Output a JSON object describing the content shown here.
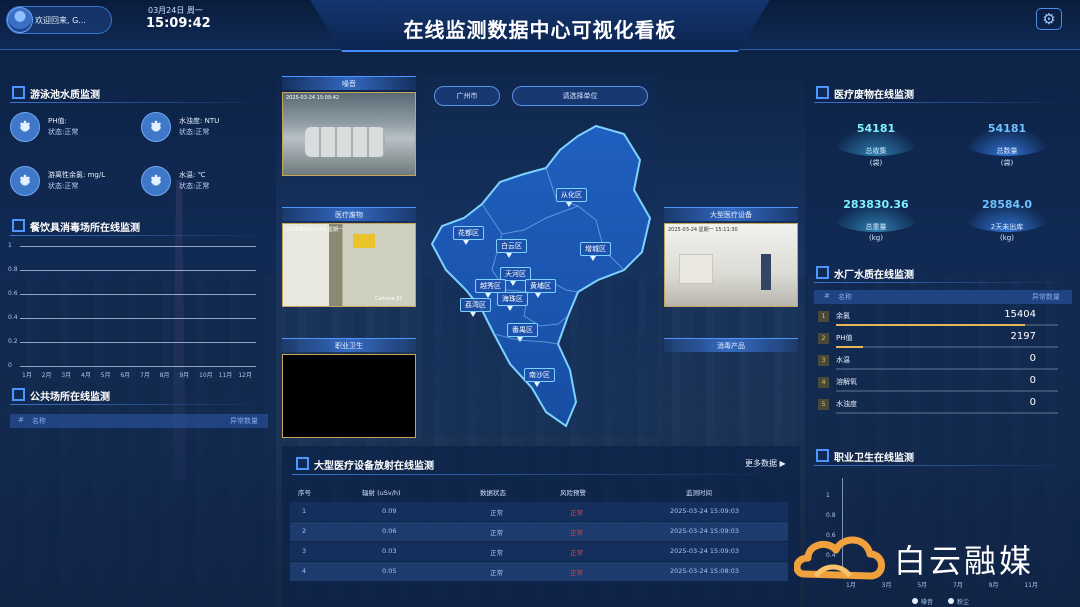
{
  "header": {
    "welcome": "欢迎回来, G...",
    "date": "03月24日 周一",
    "time": "15:09:42",
    "title": "在线监测数据中心可视化看板"
  },
  "pool": {
    "title": "游泳池水质监测",
    "items": [
      {
        "label": "PH值:",
        "status": "状态:正常"
      },
      {
        "label": "水浊度: NTU",
        "status": "状态:正常"
      },
      {
        "label": "游离性余氯: mg/L",
        "status": "状态:正常"
      },
      {
        "label": "水温: ℃",
        "status": "状态:正常"
      }
    ]
  },
  "tableware": {
    "title": "餐饮具消毒场所在线监测",
    "y_ticks": [
      "1",
      "0.8",
      "0.6",
      "0.4",
      "0.2",
      "0"
    ],
    "x_ticks": [
      "1月",
      "2月",
      "3月",
      "4月",
      "5月",
      "6月",
      "7月",
      "8月",
      "9月",
      "10月",
      "11月",
      "12月"
    ]
  },
  "public_places": {
    "title": "公共场所在线监测",
    "col_index": "#",
    "col_name": "名称",
    "col_abnormal": "异常数量"
  },
  "cameras": {
    "noise": {
      "label": "噪音",
      "stamp": "2025-03-24 15:09:42"
    },
    "medical_waste": {
      "label": "医疗废物",
      "stamp": "2025年03月24日 星期一",
      "cam_label": "Camera 01"
    },
    "occupational": {
      "label": "职业卫生"
    },
    "large_device": {
      "label": "大型医疗设备",
      "stamp": "2025-03-24 星期一 15:11:30"
    },
    "disinfect": {
      "label": "消毒产品"
    }
  },
  "map": {
    "city_select": "广州市",
    "unit_select": "请选择单位",
    "districts": [
      "从化区",
      "花都区",
      "白云区",
      "增城区",
      "天河区",
      "越秀区",
      "黄埔区",
      "荔湾区",
      "海珠区",
      "番禺区",
      "南沙区"
    ]
  },
  "radiation": {
    "title": "大型医疗设备放射在线监测",
    "more": "更多数据 ▶",
    "headers": [
      "序号",
      "辐射 (uSv/h)",
      "数据状态",
      "风险预警",
      "监测时间"
    ],
    "rows": [
      {
        "idx": "1",
        "value": "0.09",
        "status": "正常",
        "risk": "正常",
        "time": "2025-03-24 15:09:03"
      },
      {
        "idx": "2",
        "value": "0.06",
        "status": "正常",
        "risk": "正常",
        "time": "2025-03-24 15:09:03"
      },
      {
        "idx": "3",
        "value": "0.03",
        "status": "正常",
        "risk": "正常",
        "time": "2025-03-24 15:09:03"
      },
      {
        "idx": "4",
        "value": "0.05",
        "status": "正常",
        "risk": "正常",
        "time": "2025-03-24 15:08:03"
      }
    ]
  },
  "medwaste": {
    "title": "医疗废物在线监测",
    "stats": [
      {
        "value": "54181",
        "name": "总收集",
        "unit": "(袋)"
      },
      {
        "value": "54181",
        "name": "总数量",
        "unit": "(袋)"
      },
      {
        "value": "283830.36",
        "name": "总重量",
        "unit": "(kg)"
      },
      {
        "value": "28584.0",
        "name": "2天未出库",
        "unit": "(kg)"
      }
    ]
  },
  "waterplant": {
    "title": "水厂水质在线监测",
    "col_index": "#",
    "col_name": "名称",
    "col_abnormal": "异常数量",
    "rows": [
      {
        "rank": "1",
        "name": "余氯",
        "value": "15404",
        "fill": 0.85
      },
      {
        "rank": "2",
        "name": "PH值",
        "value": "2197",
        "fill": 0.12
      },
      {
        "rank": "3",
        "name": "水温",
        "value": "0",
        "fill": 0
      },
      {
        "rank": "4",
        "name": "溶解氧",
        "value": "0",
        "fill": 0
      },
      {
        "rank": "5",
        "name": "水浊度",
        "value": "0",
        "fill": 0
      }
    ]
  },
  "occhealth": {
    "title": "职业卫生在线监测",
    "y_ticks": [
      "1",
      "0.8",
      "0.6",
      "0.4",
      "0.2"
    ],
    "x_ticks": [
      "1月",
      "3月",
      "5月",
      "7月",
      "9月",
      "11月"
    ],
    "legend": [
      "噪音",
      "粉尘"
    ]
  },
  "logo": {
    "text": "白云融媒"
  }
}
